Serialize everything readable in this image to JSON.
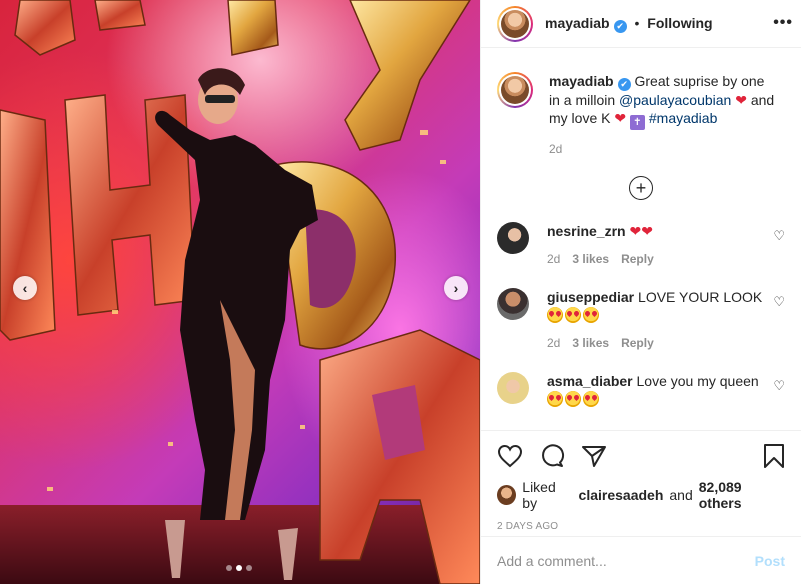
{
  "post": {
    "username": "mayadiab",
    "following_label": "Following",
    "separator": "•",
    "more_label": "•••",
    "verified_mark": "✔"
  },
  "caption": {
    "username": "mayadiab",
    "text_1": "Great suprise by one in a milloin",
    "mention": "@paulayacoubian",
    "heart_1": "❤",
    "text_2": "and my love K",
    "heart_2": "❤",
    "cross": "✝",
    "hashtag": "#mayadiab",
    "time": "2d"
  },
  "load_more": {
    "icon": "+"
  },
  "comments": [
    {
      "username": "nesrine_zrn",
      "text": "❤❤",
      "time": "2d",
      "likes": "3 likes",
      "reply": "Reply",
      "like_icon": "♡"
    },
    {
      "username": "giuseppediar",
      "text": "LOVE YOUR LOOK",
      "emoji_count": 3,
      "time": "2d",
      "likes": "3 likes",
      "reply": "Reply",
      "like_icon": "♡"
    },
    {
      "username": "asma_diaber",
      "text": "Love you my queen",
      "like_icon": "♡"
    }
  ],
  "actions": {
    "like_icon": "heart-outline-icon",
    "comment_icon": "comment-bubble-icon",
    "share_icon": "paper-plane-icon",
    "save_icon": "bookmark-icon"
  },
  "likes": {
    "prefix": "Liked by",
    "user": "clairesaadeh",
    "middle": "and",
    "others": "82,089 others"
  },
  "post_time": "2 DAYS AGO",
  "add_comment": {
    "placeholder": "Add a comment...",
    "post_label": "Post"
  },
  "carousel": {
    "prev_icon": "‹",
    "next_icon": "›",
    "total": 3,
    "active": 2
  },
  "colors": {
    "accent": "#3897f0",
    "heart": "#e0243a",
    "post_disabled": "#b2dffc",
    "mention": "#00376b"
  }
}
